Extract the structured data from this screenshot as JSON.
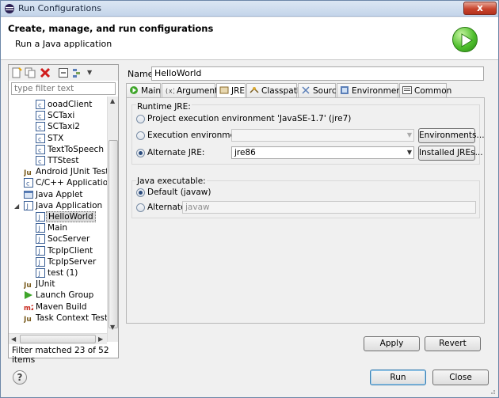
{
  "window": {
    "title": "Run Configurations",
    "close_glyph": "x"
  },
  "header": {
    "title": "Create, manage, and run configurations",
    "subtitle": "Run a Java application",
    "logo_icon": "run-circle-icon"
  },
  "left": {
    "toolbar_icons": [
      "new-config-icon",
      "duplicate-icon",
      "delete-icon",
      "collapse-all-icon",
      "filter-icon"
    ],
    "filter_placeholder": "type filter text",
    "tree": [
      {
        "label": "ooadClient",
        "icon": "c-app-icon",
        "indent": 2
      },
      {
        "label": "SCTaxi",
        "icon": "c-app-icon",
        "indent": 2
      },
      {
        "label": "SCTaxi2",
        "icon": "c-app-icon",
        "indent": 2
      },
      {
        "label": "STX",
        "icon": "c-app-icon",
        "indent": 2
      },
      {
        "label": "TextToSpeech",
        "icon": "c-app-icon",
        "indent": 2
      },
      {
        "label": "TTStest",
        "icon": "c-app-icon",
        "indent": 2
      },
      {
        "label": "Android JUnit Test",
        "icon": "junit-icon",
        "indent": 1
      },
      {
        "label": "C/C++ Application",
        "icon": "c-app-icon",
        "indent": 1
      },
      {
        "label": "Java Applet",
        "icon": "applet-icon",
        "indent": 1
      },
      {
        "label": "Java Application",
        "icon": "java-app-icon",
        "indent": 1,
        "expanded": true
      },
      {
        "label": "HelloWorld",
        "icon": "java-app-icon",
        "indent": 2,
        "selected": true
      },
      {
        "label": "Main",
        "icon": "java-app-icon",
        "indent": 2
      },
      {
        "label": "SocServer",
        "icon": "java-app-icon",
        "indent": 2
      },
      {
        "label": "TcpIpClient",
        "icon": "java-app-icon",
        "indent": 2
      },
      {
        "label": "TcpIpServer",
        "icon": "java-app-icon",
        "indent": 2
      },
      {
        "label": "test (1)",
        "icon": "java-app-icon",
        "indent": 2
      },
      {
        "label": "JUnit",
        "icon": "junit-icon",
        "indent": 1
      },
      {
        "label": "Launch Group",
        "icon": "launch-group-icon",
        "indent": 1
      },
      {
        "label": "Maven Build",
        "icon": "maven-icon",
        "indent": 1
      },
      {
        "label": "Task Context Test",
        "icon": "junit-icon",
        "indent": 1
      }
    ],
    "status": "Filter matched 23 of 52 items"
  },
  "config": {
    "name_label": "Name:",
    "name_value": "HelloWorld",
    "tabs": [
      {
        "label": "Main",
        "icon": "main-tab-icon"
      },
      {
        "label": "Arguments",
        "icon": "arguments-icon"
      },
      {
        "label": "JRE",
        "icon": "jre-icon",
        "active": true
      },
      {
        "label": "Classpath",
        "icon": "classpath-icon"
      },
      {
        "label": "Source",
        "icon": "source-icon"
      },
      {
        "label": "Environment",
        "icon": "environment-icon"
      },
      {
        "label": "Common",
        "icon": "common-icon"
      }
    ],
    "runtime_jre": {
      "title": "Runtime JRE:",
      "project_env_label": "Project execution environment 'JavaSE-1.7' (jre7)",
      "exec_env_label": "Execution environment:",
      "exec_env_value": "",
      "environments_button": "Environments...",
      "alternate_label": "Alternate JRE:",
      "alternate_value": "jre86",
      "installed_button": "Installed JREs...",
      "selected": "alternate"
    },
    "java_executable": {
      "title": "Java executable:",
      "default_label": "Default (javaw)",
      "alternate_label": "Alternate",
      "alternate_value": "javaw",
      "selected": "default"
    },
    "apply_button": "Apply",
    "revert_button": "Revert"
  },
  "footer": {
    "help_glyph": "?",
    "run_button": "Run",
    "close_button": "Close"
  }
}
